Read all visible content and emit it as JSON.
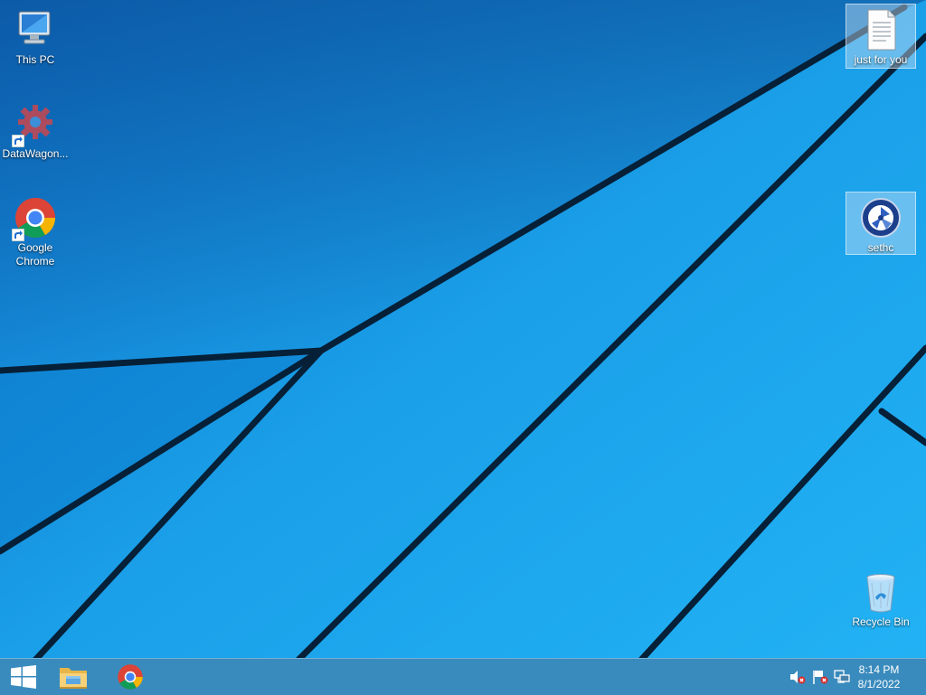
{
  "desktop": {
    "icons_left": [
      {
        "label": "This PC"
      },
      {
        "label": "DataWagon..."
      },
      {
        "label": "Google Chrome"
      }
    ],
    "icons_right": [
      {
        "label": "just for you",
        "selected": true
      },
      {
        "label": "sethc",
        "selected": true
      },
      {
        "label": "Recycle Bin",
        "selected": false
      }
    ]
  },
  "taskbar": {
    "start_icon": "windows-logo-icon",
    "pinned": [
      "file-explorer-icon",
      "chrome-icon"
    ],
    "tray": [
      "volume-muted-icon",
      "action-center-flag-icon",
      "network-icon"
    ],
    "clock": {
      "time": "8:14 PM",
      "date": "8/1/2022"
    }
  },
  "colors": {
    "wallpaper_blue": "#1aa3ee",
    "wallpaper_dark": "#0a3f7a",
    "taskbar": "#4682aa"
  }
}
